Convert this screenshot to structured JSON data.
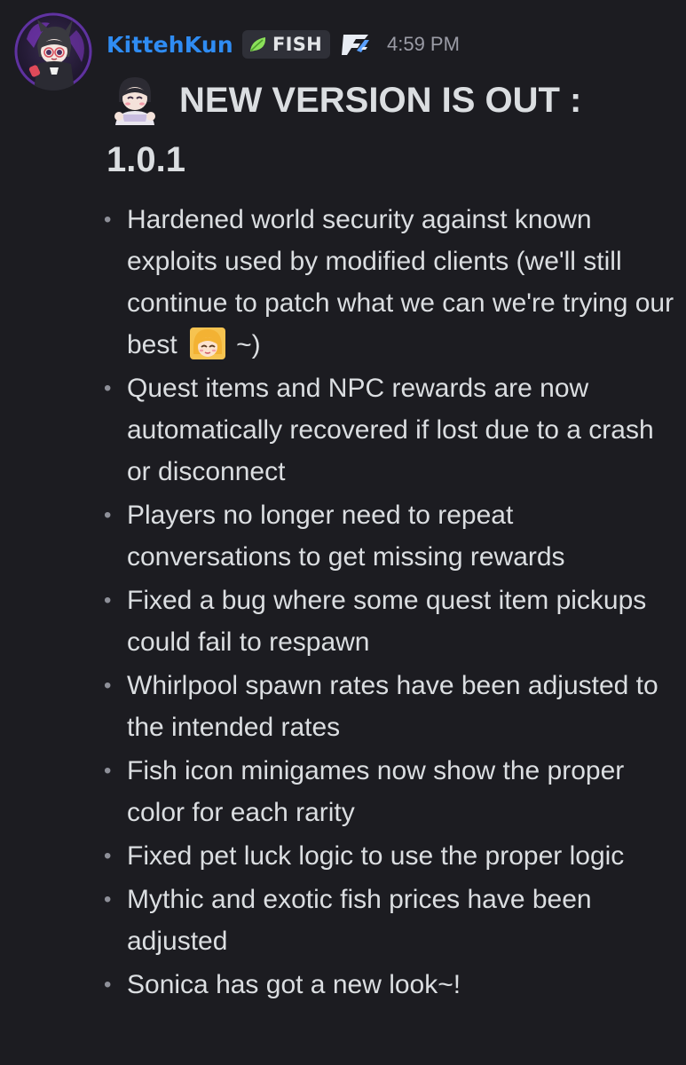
{
  "author": {
    "username": "KittehKun",
    "avatar_icon": "avatar-icon",
    "tag": {
      "icon": "leaf-icon",
      "label": "FISH"
    },
    "role_icon": "game-logo-icon",
    "timestamp": "4:59 PM"
  },
  "message": {
    "heading_emoji": "character-emoji-icon",
    "heading": "NEW VERSION IS OUT : 1.0.1",
    "changes": [
      {
        "text": "Hardened world security against known exploits used by modified clients (we'll still continue to patch what we can we're trying our best",
        "emoji": "smiling-girl-emoji-icon",
        "suffix": "~)"
      },
      {
        "text": "Quest items and NPC rewards are now automatically recovered if lost due to a crash or disconnect"
      },
      {
        "text": "Players no longer need to repeat conversations to get missing rewards"
      },
      {
        "text": "Fixed a bug where some quest item pickups could fail to respawn"
      },
      {
        "text": "Whirlpool spawn rates have been adjusted to the intended rates"
      },
      {
        "text": "Fish icon minigames now show the proper color for each rarity"
      },
      {
        "text": "Fixed pet luck logic to use the proper logic"
      },
      {
        "text": "Mythic and exotic fish prices have been adjusted"
      },
      {
        "text": "Sonica has got a new look~!"
      }
    ]
  },
  "colors": {
    "background": "#1c1c21",
    "username": "#2f8cf3",
    "text": "#dbdee1",
    "timestamp": "#9b9ca6",
    "tag_background": "#2f3038",
    "leaf": "#8be05a"
  }
}
